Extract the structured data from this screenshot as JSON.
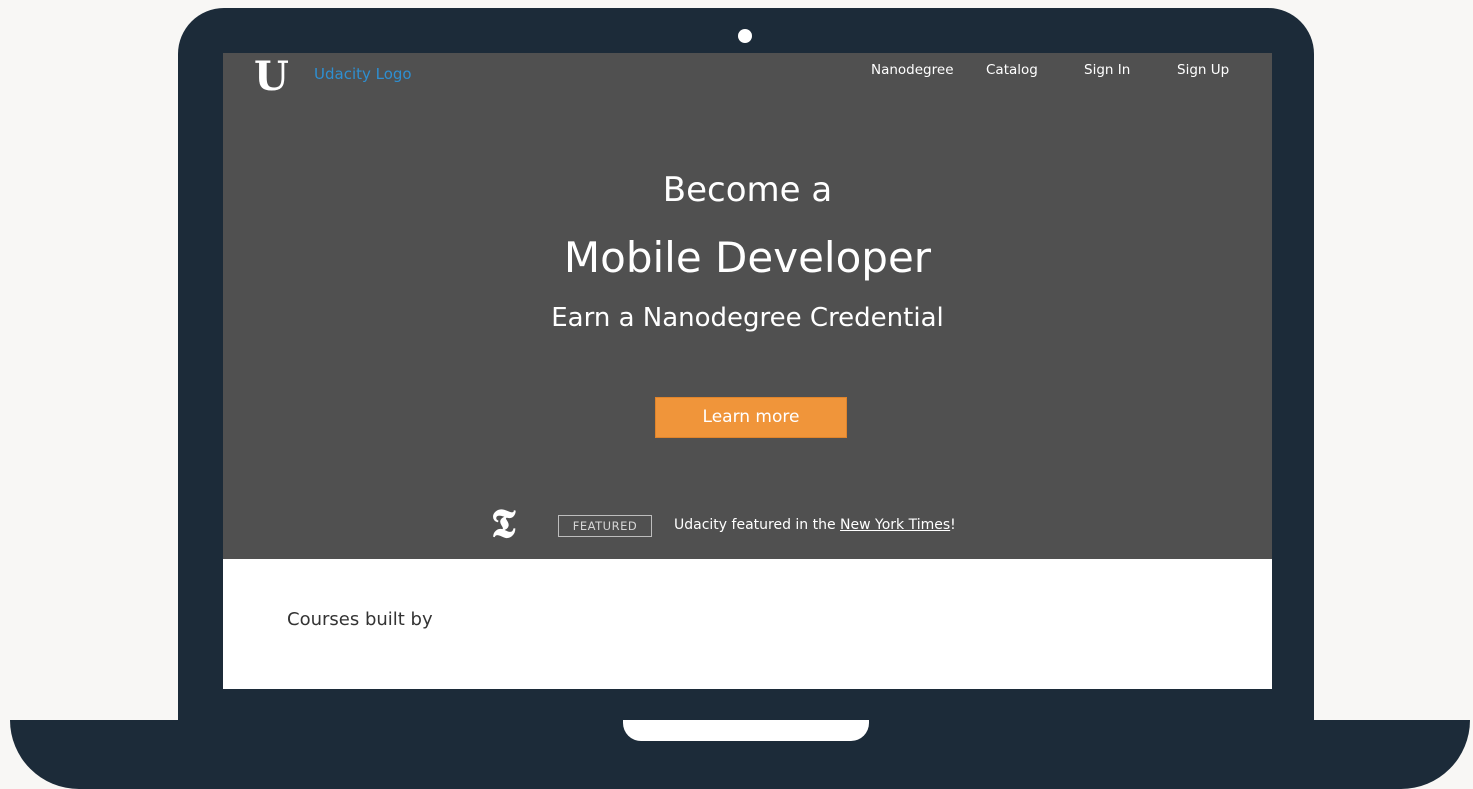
{
  "brand": {
    "logo_letter": "U",
    "logo_text": "Udacity Logo"
  },
  "nav": {
    "items": [
      {
        "label": "Nanodegree"
      },
      {
        "label": "Catalog"
      },
      {
        "label": "Sign In"
      },
      {
        "label": "Sign Up"
      }
    ]
  },
  "hero": {
    "line1": "Become a",
    "line2": "Mobile Developer",
    "line3": "Earn a Nanodegree Credential",
    "cta_label": "Learn more"
  },
  "featured": {
    "icon_glyph": "𝕿",
    "badge": "FEATURED",
    "text_prefix": "Udacity featured in the ",
    "link_text": "New York Times",
    "text_suffix": "!"
  },
  "section": {
    "courses_label": "Courses built by"
  },
  "colors": {
    "hero_bg": "#505050",
    "cta": "#f0953a",
    "logo_text": "#2e8fd1",
    "frame": "#1c2b39"
  }
}
